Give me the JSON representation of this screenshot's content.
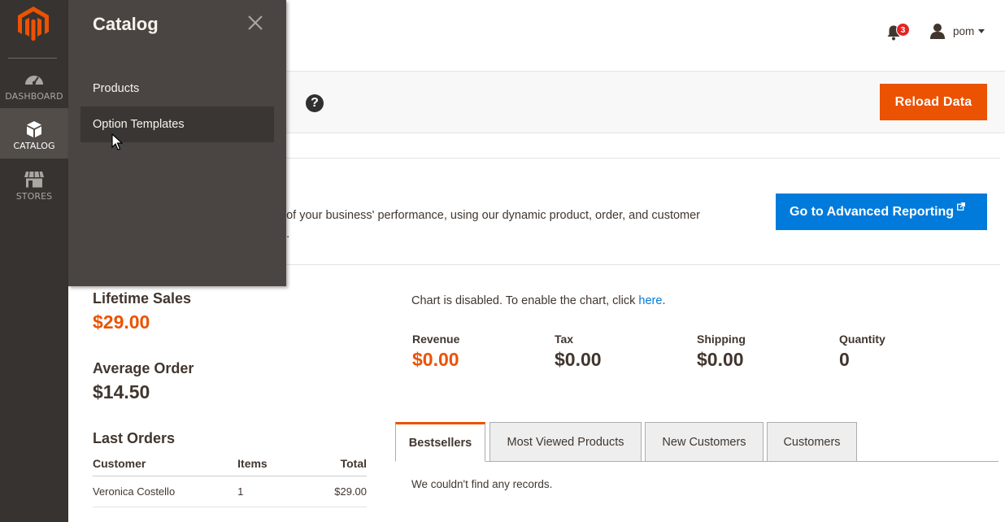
{
  "sidebar": {
    "items": [
      {
        "label": "DASHBOARD",
        "icon": "dashboard-gauge-icon",
        "active": false
      },
      {
        "label": "CATALOG",
        "icon": "catalog-box-icon",
        "active": true
      },
      {
        "label": "STORES",
        "icon": "stores-shop-icon",
        "active": false
      }
    ]
  },
  "flyout": {
    "title": "Catalog",
    "items": [
      "Products",
      "Option Templates"
    ],
    "hovered": "Option Templates"
  },
  "header": {
    "notifications_count": "3",
    "user_name": "pom"
  },
  "actions": {
    "help_symbol": "?",
    "reload_label": "Reload Data"
  },
  "advanced_reporting": {
    "text_line1": "d of your business' performance, using our dynamic product, order, and customer",
    "text_line2": "ta.",
    "button_label": "Go to Advanced Reporting"
  },
  "stats": {
    "lifetime_sales_label": "Lifetime Sales",
    "lifetime_sales_value": "$29.00",
    "average_order_label": "Average Order",
    "average_order_value": "$14.50"
  },
  "last_orders": {
    "title": "Last Orders",
    "columns": [
      "Customer",
      "Items",
      "Total"
    ],
    "rows": [
      {
        "customer": "Veronica Costello",
        "items": "1",
        "total": "$29.00"
      }
    ]
  },
  "chart": {
    "disabled_text": "Chart is disabled. To enable the chart, click",
    "link_text": "here",
    "trailing": "."
  },
  "totals": [
    {
      "label": "Revenue",
      "value": "$0.00"
    },
    {
      "label": "Tax",
      "value": "$0.00"
    },
    {
      "label": "Shipping",
      "value": "$0.00"
    },
    {
      "label": "Quantity",
      "value": "0"
    }
  ],
  "tabs": {
    "items": [
      "Bestsellers",
      "Most Viewed Products",
      "New Customers",
      "Customers"
    ],
    "active": "Bestsellers",
    "empty_message": "We couldn't find any records."
  },
  "colors": {
    "accent_orange": "#eb5202",
    "link_blue": "#007bdb",
    "sidebar_bg": "#373330",
    "flyout_bg": "#4a4542"
  }
}
